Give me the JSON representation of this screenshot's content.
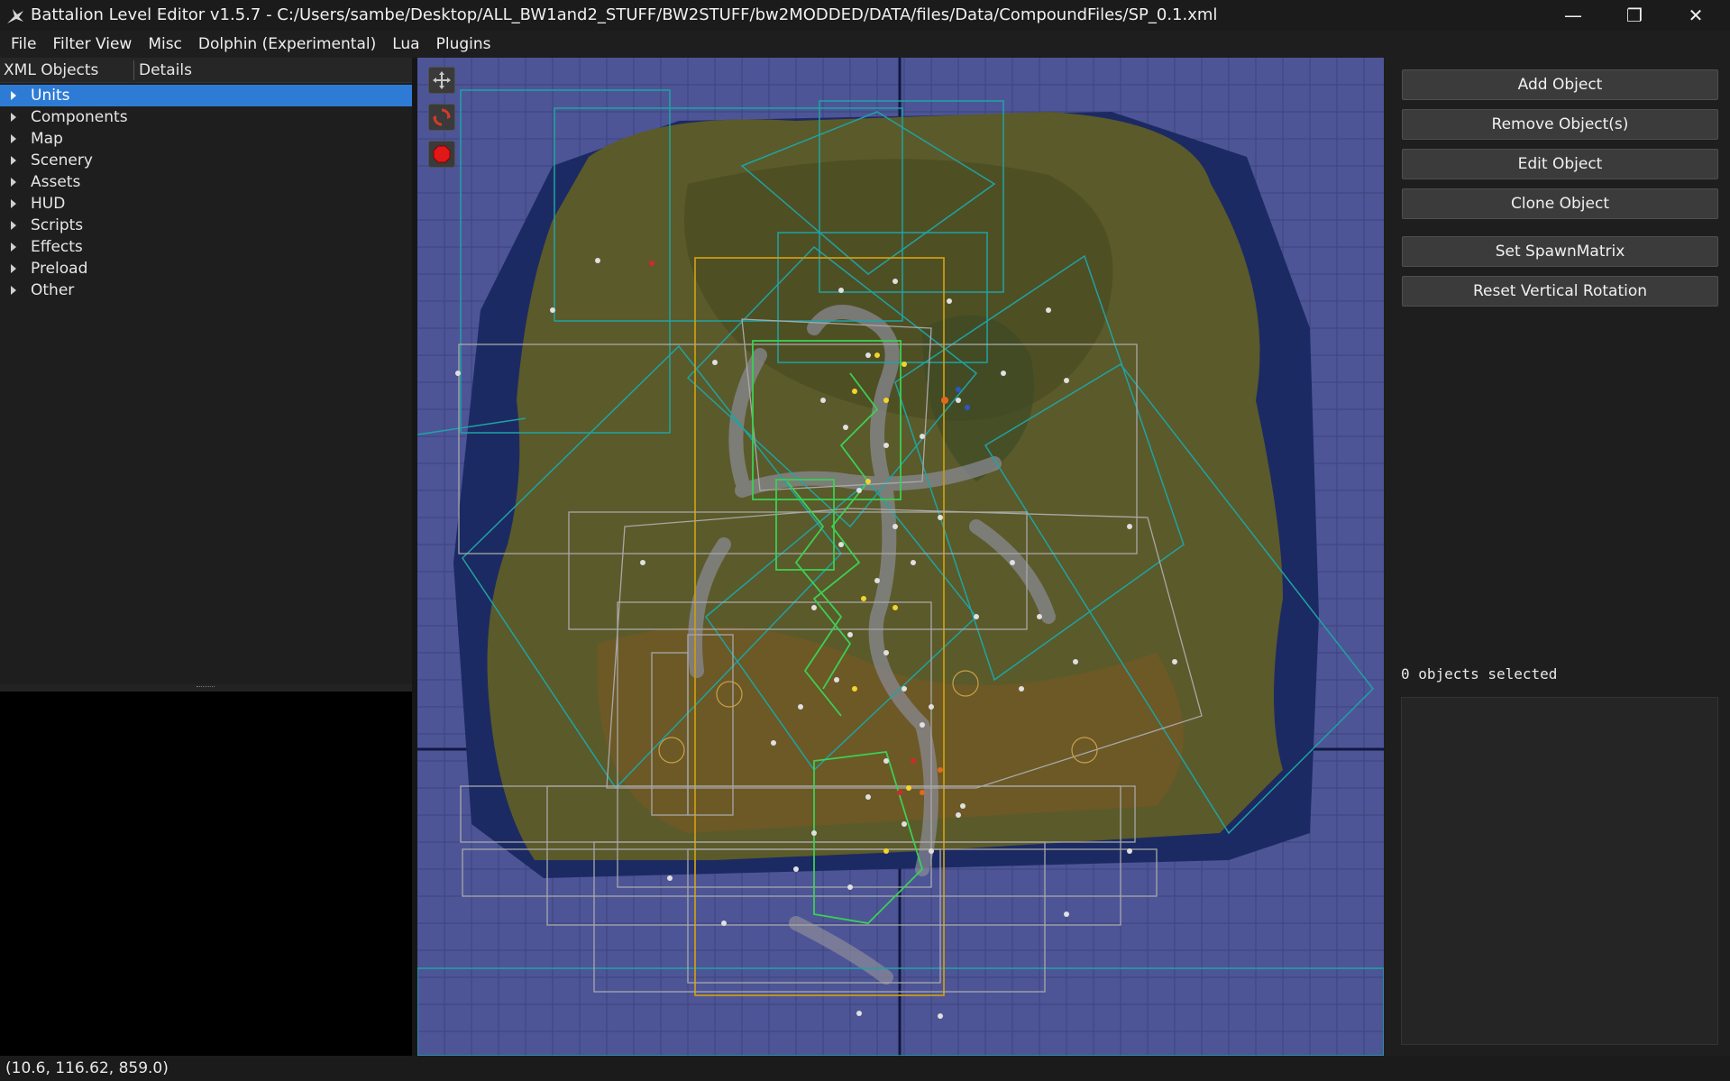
{
  "window": {
    "title": "Battalion Level Editor v1.5.7 - C:/Users/sambe/Desktop/ALL_BW1and2_STUFF/BW2STUFF/bw2MODDED/DATA/files/Data/CompoundFiles/SP_0.1.xml",
    "minimize_glyph": "—",
    "restore_glyph": "❐",
    "close_glyph": "✕"
  },
  "menu": {
    "items": [
      "File",
      "Filter View",
      "Misc",
      "Dolphin (Experimental)",
      "Lua",
      "Plugins"
    ]
  },
  "tree": {
    "headers": [
      "XML Objects",
      "Details"
    ],
    "items": [
      "Units",
      "Components",
      "Map",
      "Scenery",
      "Assets",
      "HUD",
      "Scripts",
      "Effects",
      "Preload",
      "Other"
    ],
    "selected": "Units"
  },
  "viewport": {
    "tools": [
      "move-tool-icon",
      "rotate-tool-icon",
      "stop-tool-icon"
    ],
    "colors": {
      "water": "#4d5597",
      "deep_water": "#1c2a63",
      "terrain": "#5b5a2a",
      "teal_lines": "#1fa3a3",
      "green_lines": "#3ccf55",
      "yellow_lines": "#c89a14",
      "gray_lines": "#a0a0a0"
    }
  },
  "actions": {
    "buttons": [
      "Add Object",
      "Remove Object(s)",
      "Edit Object",
      "Clone Object",
      "Set SpawnMatrix",
      "Reset Vertical Rotation"
    ]
  },
  "selection": {
    "count_text": "0 objects selected"
  },
  "status": {
    "coords": "(10.6, 116.62, 859.0)"
  }
}
